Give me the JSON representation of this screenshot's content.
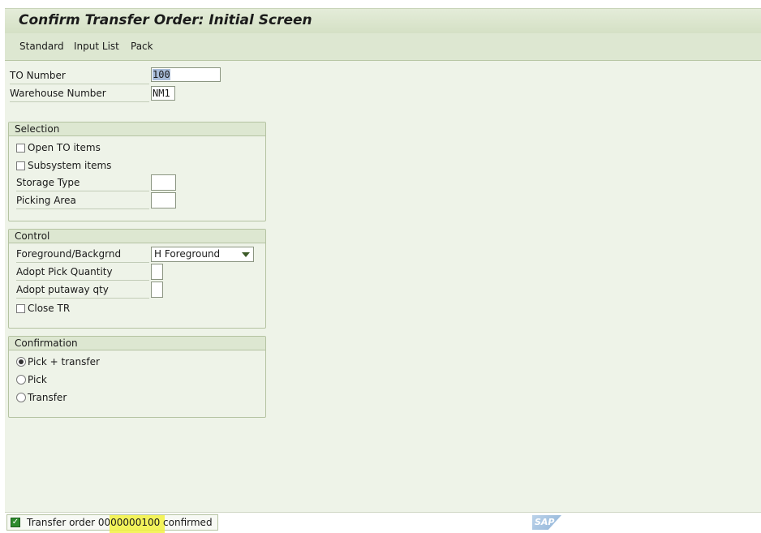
{
  "window": {
    "title": "Confirm Transfer Order: Initial Screen"
  },
  "menu": {
    "items": [
      "Standard",
      "Input List",
      "Pack"
    ]
  },
  "header_fields": {
    "to_number": {
      "label": "TO Number",
      "value": "100"
    },
    "warehouse_number": {
      "label": "Warehouse Number",
      "value": "NM1"
    }
  },
  "selection": {
    "title": "Selection",
    "open_to_items": {
      "label": "Open TO items",
      "checked": false
    },
    "subsystem_items": {
      "label": "Subsystem items",
      "checked": false
    },
    "storage_type": {
      "label": "Storage Type",
      "value": ""
    },
    "picking_area": {
      "label": "Picking Area",
      "value": ""
    }
  },
  "control": {
    "title": "Control",
    "foreground_backgrnd": {
      "label": "Foreground/Backgrnd",
      "value": "H Foreground"
    },
    "adopt_pick_quantity": {
      "label": "Adopt Pick Quantity",
      "value": ""
    },
    "adopt_putaway_qty": {
      "label": "Adopt putaway qty",
      "value": ""
    },
    "close_tr": {
      "label": "Close TR",
      "checked": false
    }
  },
  "confirmation": {
    "title": "Confirmation",
    "options": [
      {
        "label": "Pick + transfer",
        "selected": true
      },
      {
        "label": "Pick",
        "selected": false
      },
      {
        "label": "Transfer",
        "selected": false
      }
    ]
  },
  "status": {
    "message": "Transfer order 0000000100 confirmed",
    "type": "success"
  },
  "branding": {
    "logo_text": "SAP"
  },
  "colors": {
    "background": "#eef3e8",
    "title_bar": "#dde7d1",
    "highlight": "#f2f240",
    "success": "#2e8b2e"
  }
}
